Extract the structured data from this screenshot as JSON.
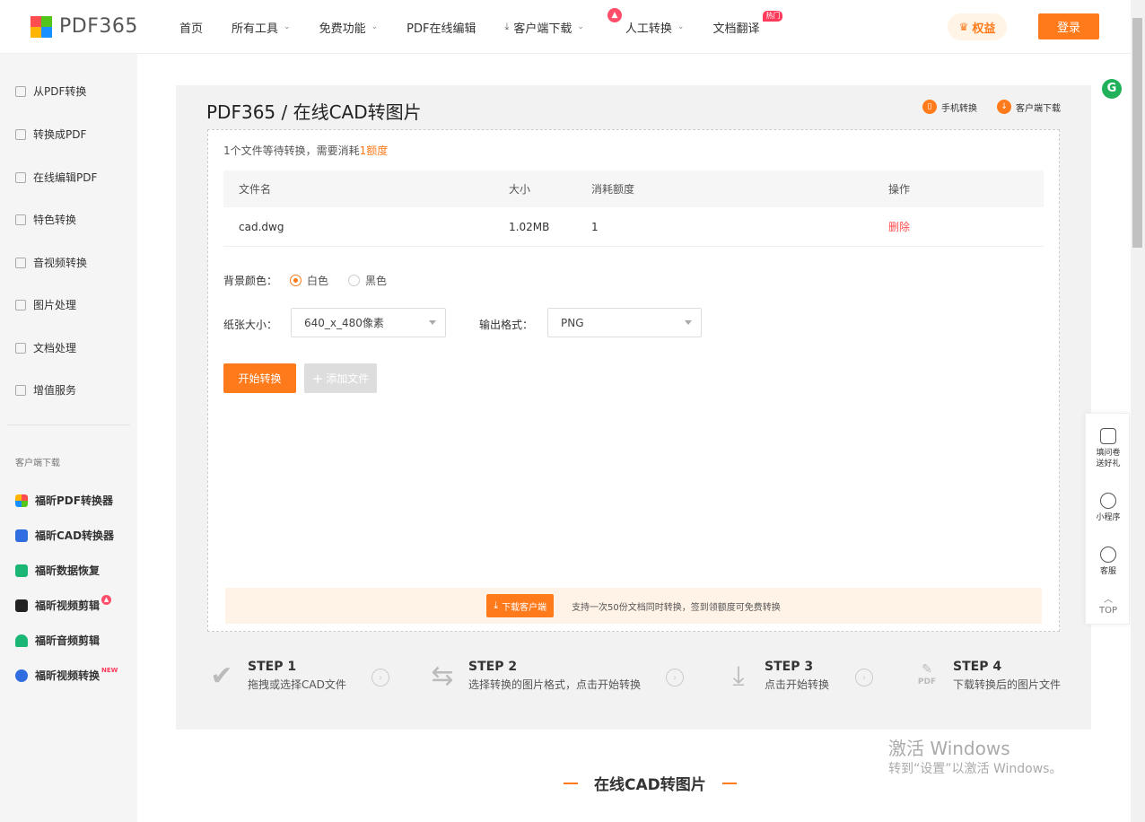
{
  "brand": {
    "name": "PDF365"
  },
  "nav": {
    "home": "首页",
    "all_tools": "所有工具",
    "free": "免费功能",
    "online_edit": "PDF在线编辑",
    "client_download": "客户端下载",
    "manual": "人工转换",
    "translate": "文档翻译",
    "hot_badge": "热门",
    "rights": "权益",
    "login": "登录"
  },
  "sidebar": {
    "items": [
      {
        "label": "从PDF转换"
      },
      {
        "label": "转换成PDF"
      },
      {
        "label": "在线编辑PDF"
      },
      {
        "label": "特色转换"
      },
      {
        "label": "音视频转换"
      },
      {
        "label": "图片处理"
      },
      {
        "label": "文档处理"
      },
      {
        "label": "增值服务"
      }
    ],
    "client_title": "客户端下载",
    "apps": [
      {
        "label": "福昕PDF转换器",
        "color": "#ff7a1a"
      },
      {
        "label": "福昕CAD转换器",
        "color": "#2f6de1"
      },
      {
        "label": "福昕数据恢复",
        "color": "#1bb574"
      },
      {
        "label": "福昕视频剪辑",
        "color": "#222222"
      },
      {
        "label": "福昕音频剪辑",
        "color": "#1bb574"
      },
      {
        "label": "福昕视频转换",
        "color": "#2f6de1"
      }
    ],
    "new_badge": "NEW"
  },
  "main": {
    "title": "PDF365 / 在线CAD转图片",
    "mobile_convert": "手机转换",
    "client_download": "客户端下载",
    "file_info_prefix": "1个文件等待转换，需要消耗",
    "file_info_highlight": "1额度",
    "table": {
      "headers": [
        "文件名",
        "大小",
        "消耗额度",
        "操作"
      ],
      "row": {
        "name": "cad.dwg",
        "size": "1.02MB",
        "credits": "1",
        "action": "删除"
      }
    },
    "bg_color_label": "背景颜色：",
    "bg_white": "白色",
    "bg_black": "黑色",
    "paper_label": "纸张大小：",
    "paper_value": "640_x_480像素",
    "format_label": "输出格式：",
    "format_value": "PNG",
    "start_btn": "开始转换",
    "add_btn": "添加文件",
    "notice_btn": "下载客户端",
    "notice_text": "支持一次50份文档同时转换，签到领额度可免费转换"
  },
  "steps": [
    {
      "title": "STEP 1",
      "desc": "拖拽或选择CAD文件"
    },
    {
      "title": "STEP 2",
      "desc": "选择转换的图片格式，点击开始转换"
    },
    {
      "title": "STEP 3",
      "desc": "点击开始转换"
    },
    {
      "title": "STEP 4",
      "desc": "下载转换后的图片文件"
    }
  ],
  "step4_icon_text": "PDF",
  "float": {
    "g": "G",
    "survey_1": "填问卷",
    "survey_2": "送好礼",
    "mini": "小程序",
    "service": "客服",
    "top": "TOP"
  },
  "watermark": {
    "line1": "激活 Windows",
    "line2": "转到“设置”以激活 Windows。"
  },
  "bottom_title": "在线CAD转图片"
}
